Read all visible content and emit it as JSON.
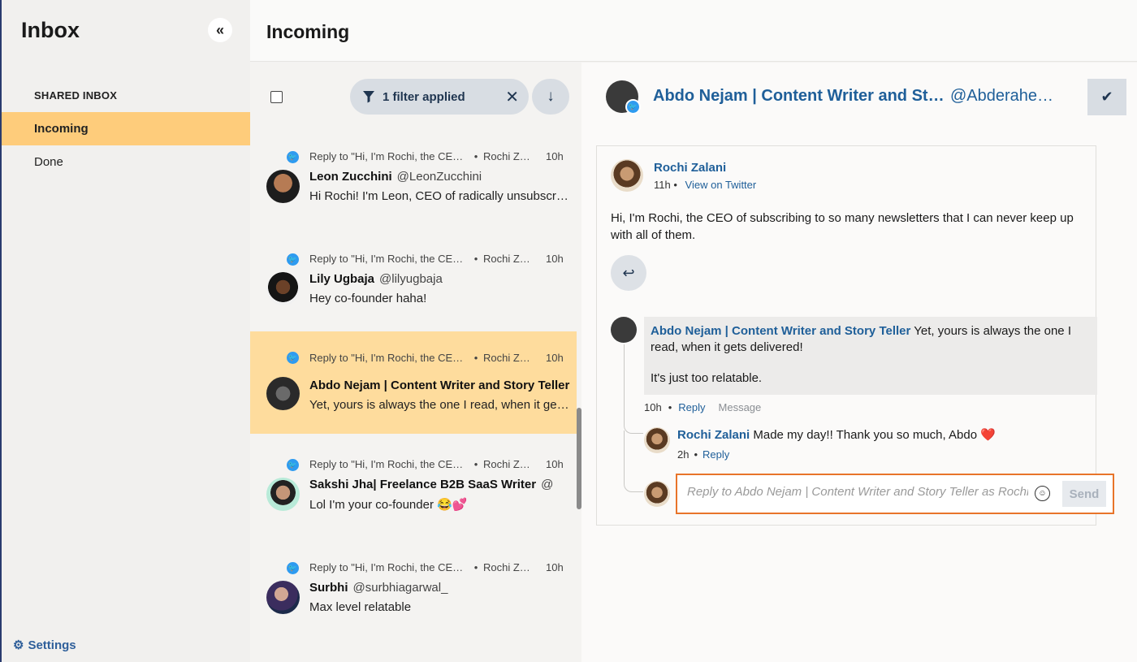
{
  "sidebar": {
    "title": "Inbox",
    "collapse_icon": "«",
    "section_label": "SHARED INBOX",
    "items": [
      {
        "label": "Incoming",
        "active": true
      },
      {
        "label": "Done",
        "active": false
      }
    ],
    "settings_label": "Settings"
  },
  "header": {
    "title": "Incoming"
  },
  "list": {
    "filter_label": "1 filter applied",
    "messages": [
      {
        "reply_to": "Reply to \"Hi, I'm Rochi, the CEO of subscribing to so many newsletters...\"",
        "recipient": "Rochi Zalani",
        "time": "10h",
        "name": "Leon Zucchini",
        "handle": "@LeonZucchini",
        "preview": "Hi Rochi! I'm Leon, CEO of radically unsubscribing from newsletters"
      },
      {
        "reply_to": "Reply to \"Hi, I'm Rochi, the CEO of subscribing to so many newsletters...\"",
        "recipient": "Rochi Zalani",
        "time": "10h",
        "name": "Lily Ugbaja",
        "handle": "@lilyugbaja",
        "preview": "Hey co-founder haha!"
      },
      {
        "reply_to": "Reply to \"Hi, I'm Rochi, the CEO of subscribing to so many newsletters...\"",
        "recipient": "Rochi Zalani",
        "time": "10h",
        "name": "Abdo Nejam | Content Writer and Story Teller",
        "handle": "@Abderahemnejam",
        "preview": "Yet, yours is always the one I read, when it gets delivered!"
      },
      {
        "reply_to": "Reply to \"Hi, I'm Rochi, the CEO of subscribing to so many newsletters...\"",
        "recipient": "Rochi Zalani",
        "time": "10h",
        "name": "Sakshi Jha| Freelance B2B SaaS Writer",
        "handle": "@",
        "preview": "Lol I'm your co-founder 😂💕"
      },
      {
        "reply_to": "Reply to \"Hi, I'm Rochi, the CEO of subscribing to so many newsletters...\"",
        "recipient": "Rochi Zalani",
        "time": "10h",
        "name": "Surbhi",
        "handle": "@surbhiagarwal_",
        "preview": "Max level relatable"
      }
    ]
  },
  "detail": {
    "header_name": "Abdo Nejam | Content Writer and Story Teller",
    "header_handle": "@Abderahemnejam",
    "post": {
      "author": "Rochi Zalani",
      "time": "11h",
      "view_link": "View on Twitter",
      "text": "Hi, I'm Rochi, the CEO of subscribing to so many newsletters that I can never keep up with all of them."
    },
    "comment1": {
      "author": "Abdo Nejam | Content Writer and Story Teller",
      "text1": "Yet, yours is always the one I read, when it gets delivered!",
      "text2": "It's just too relatable.",
      "time": "10h",
      "reply_label": "Reply",
      "message_label": "Message"
    },
    "comment2": {
      "author": "Rochi Zalani",
      "text": "Made my day!! Thank you so much, Abdo",
      "heart": "❤️",
      "time": "2h",
      "reply_label": "Reply"
    },
    "reply_box": {
      "placeholder": "Reply to Abdo Nejam | Content Writer and Story Teller as Rochi",
      "send_label": "Send"
    }
  },
  "colors": {
    "accent": "#fecc7b",
    "link": "#1f5f99",
    "focus_border": "#e8742a",
    "twitter": "#2e9bf0"
  }
}
